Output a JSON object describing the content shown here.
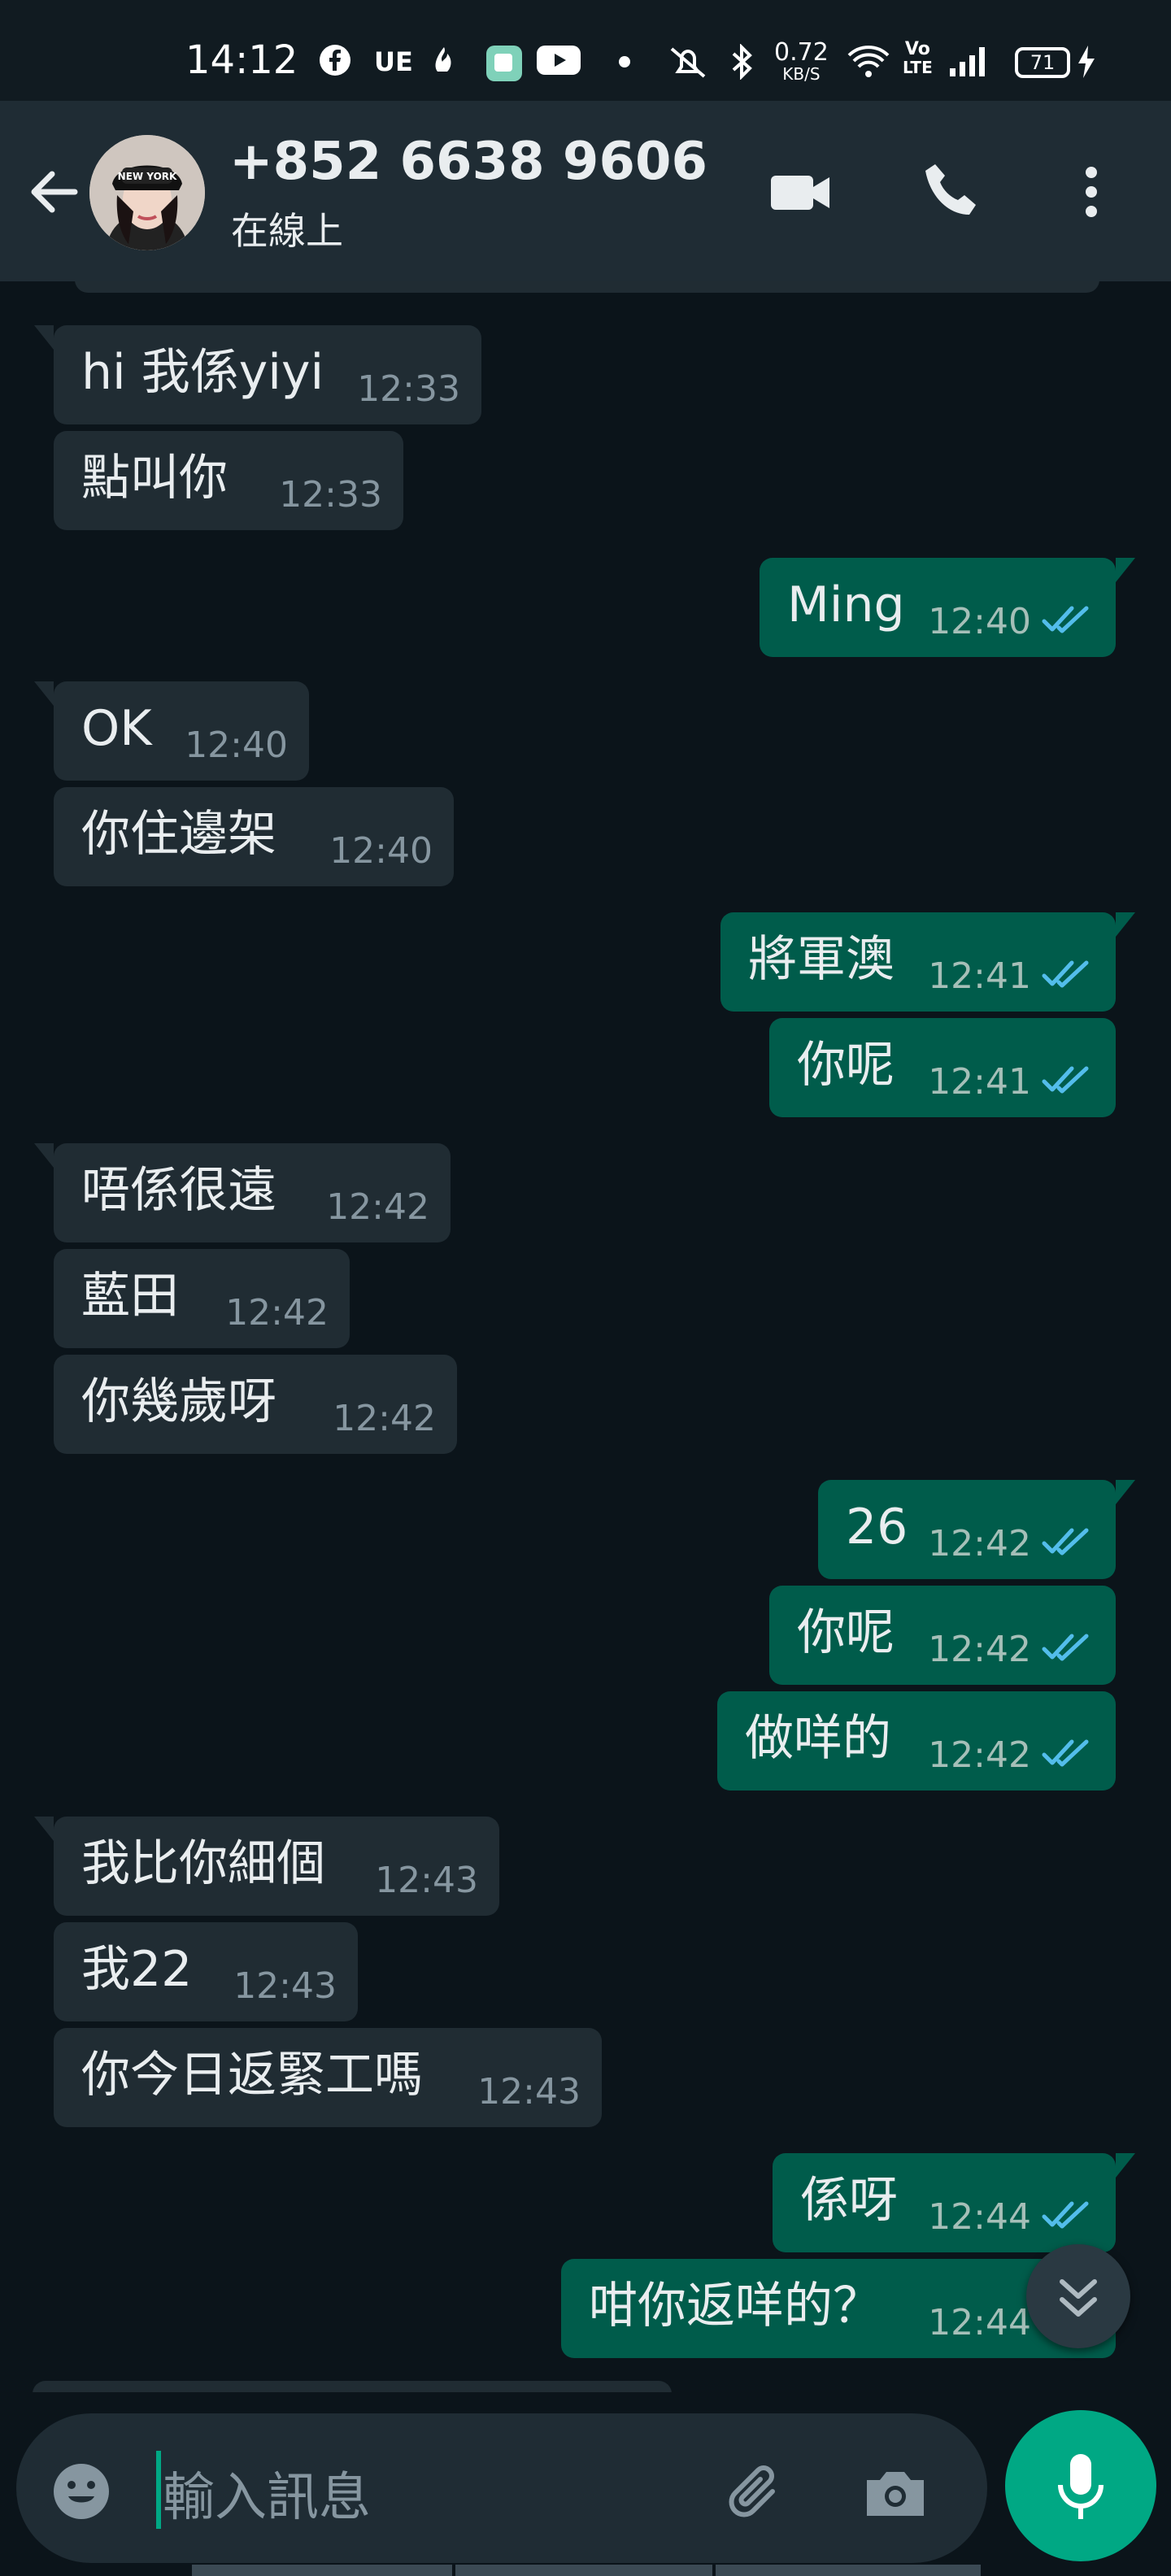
{
  "status_bar": {
    "time": "14:12",
    "app_icons": [
      "facebook-icon",
      "ue-icon",
      "flame-icon",
      "app-icon",
      "youtube-icon",
      "dot-icon"
    ],
    "ue_label": "UE",
    "net_speed_value": "0.72",
    "net_speed_unit": "KB/S",
    "volte_top": "Vo",
    "volte_bottom": "LTE",
    "battery": "71",
    "system_icons": [
      "mute-icon",
      "bluetooth-icon",
      "wifi-icon",
      "signal-icon",
      "charging-icon"
    ]
  },
  "header": {
    "contact_name": "+852 6638 9606",
    "status": "在線上",
    "avatar_text": "NEW YORK"
  },
  "messages": [
    {
      "dir": "in",
      "text": "hi 我係yiyi",
      "time": "12:33"
    },
    {
      "dir": "in",
      "text": "點叫你",
      "time": "12:33"
    },
    {
      "dir": "out",
      "text": "Ming",
      "time": "12:40"
    },
    {
      "dir": "in",
      "text": "OK",
      "time": "12:40"
    },
    {
      "dir": "in",
      "text": "你住邊架",
      "time": "12:40"
    },
    {
      "dir": "out",
      "text": "將軍澳",
      "time": "12:41"
    },
    {
      "dir": "out",
      "text": "你呢",
      "time": "12:41"
    },
    {
      "dir": "in",
      "text": "唔係很遠",
      "time": "12:42"
    },
    {
      "dir": "in",
      "text": "藍田",
      "time": "12:42"
    },
    {
      "dir": "in",
      "text": "你幾歲呀",
      "time": "12:42"
    },
    {
      "dir": "out",
      "text": "26",
      "time": "12:42"
    },
    {
      "dir": "out",
      "text": "你呢",
      "time": "12:42"
    },
    {
      "dir": "out",
      "text": "做咩的",
      "time": "12:42"
    },
    {
      "dir": "in",
      "text": "我比你細個",
      "time": "12:43"
    },
    {
      "dir": "in",
      "text": "我22",
      "time": "12:43"
    },
    {
      "dir": "in",
      "text": "你今日返緊工嗎",
      "time": "12:43"
    },
    {
      "dir": "out",
      "text": "係呀",
      "time": "12:44"
    },
    {
      "dir": "out",
      "text": "咁你返咩的？",
      "time": "12:44"
    }
  ],
  "composer": {
    "placeholder": "輸入訊息"
  },
  "colors": {
    "background": "#0b141a",
    "header": "#1f2c34",
    "incoming_bubble": "#202c33",
    "outgoing_bubble": "#005c4b",
    "accent": "#00a884",
    "read_ticks": "#53bdeb"
  }
}
